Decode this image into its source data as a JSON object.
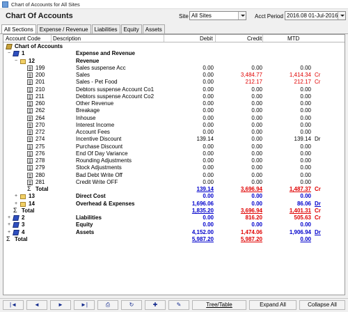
{
  "window": {
    "title": "Chart of Accounts for All Sites"
  },
  "header": {
    "title": "Chart Of Accounts",
    "site_label": "Site",
    "site_value": "All Sites",
    "period_label": "Acct Period",
    "period_value": "2016.08 01-Jul-2016"
  },
  "tabs": [
    "All Sections",
    "Expense / Revenue",
    "Liabilities",
    "Equity",
    "Assets"
  ],
  "columns": {
    "code": "Account Code",
    "desc": "Description",
    "debit": "Debit",
    "credit": "Credit",
    "mtd": "MTD"
  },
  "rows": [
    {
      "icon": "root-book-icon",
      "code": "Chart of Accounts",
      "desc": "",
      "debit": "",
      "credit": "",
      "mtd": "",
      "dc": ""
    },
    {
      "icon": "book-icon",
      "code": "1",
      "desc": "Expense and Revenue",
      "debit": "",
      "credit": "",
      "mtd": "",
      "dc": ""
    },
    {
      "icon": "folder-icon",
      "code": "12",
      "desc": "Revenue",
      "debit": "",
      "credit": "",
      "mtd": "",
      "dc": ""
    },
    {
      "icon": "doc-icon",
      "code": "199",
      "desc": "Sales suspense Acc",
      "debit": "0.00",
      "credit": "0.00",
      "mtd": "0.00",
      "dc": ""
    },
    {
      "icon": "doc-icon",
      "code": "200",
      "desc": "Sales",
      "debit": "0.00",
      "credit": "3,484.77",
      "mtd": "1,414.34",
      "dc": "Cr"
    },
    {
      "icon": "doc-icon",
      "code": "201",
      "desc": "Sales - Pet Food",
      "debit": "0.00",
      "credit": "212.17",
      "mtd": "212.17",
      "dc": "Cr"
    },
    {
      "icon": "doc-icon",
      "code": "210",
      "desc": "Debtors suspense Account Co1",
      "debit": "0.00",
      "credit": "0.00",
      "mtd": "0.00",
      "dc": ""
    },
    {
      "icon": "doc-icon",
      "code": "211",
      "desc": "Debtors suspense Account Co2",
      "debit": "0.00",
      "credit": "0.00",
      "mtd": "0.00",
      "dc": ""
    },
    {
      "icon": "doc-icon",
      "code": "260",
      "desc": "Other Revenue",
      "debit": "0.00",
      "credit": "0.00",
      "mtd": "0.00",
      "dc": ""
    },
    {
      "icon": "doc-icon",
      "code": "262",
      "desc": "Breakage",
      "debit": "0.00",
      "credit": "0.00",
      "mtd": "0.00",
      "dc": ""
    },
    {
      "icon": "doc-icon",
      "code": "264",
      "desc": "Inhouse",
      "debit": "0.00",
      "credit": "0.00",
      "mtd": "0.00",
      "dc": ""
    },
    {
      "icon": "doc-icon",
      "code": "270",
      "desc": "Interest Income",
      "debit": "0.00",
      "credit": "0.00",
      "mtd": "0.00",
      "dc": ""
    },
    {
      "icon": "doc-icon",
      "code": "272",
      "desc": "Account Fees",
      "debit": "0.00",
      "credit": "0.00",
      "mtd": "0.00",
      "dc": ""
    },
    {
      "icon": "doc-icon",
      "code": "274",
      "desc": "Incentive Discount",
      "debit": "139.14",
      "credit": "0.00",
      "mtd": "139.14",
      "dc": "Dr"
    },
    {
      "icon": "doc-icon",
      "code": "275",
      "desc": "Purchase Discount",
      "debit": "0.00",
      "credit": "0.00",
      "mtd": "0.00",
      "dc": ""
    },
    {
      "icon": "doc-icon",
      "code": "276",
      "desc": "End Of Day Variance",
      "debit": "0.00",
      "credit": "0.00",
      "mtd": "0.00",
      "dc": ""
    },
    {
      "icon": "doc-icon",
      "code": "278",
      "desc": "Rounding Adjustments",
      "debit": "0.00",
      "credit": "0.00",
      "mtd": "0.00",
      "dc": ""
    },
    {
      "icon": "doc-icon",
      "code": "279",
      "desc": "Stock Adjustments",
      "debit": "0.00",
      "credit": "0.00",
      "mtd": "0.00",
      "dc": ""
    },
    {
      "icon": "doc-icon",
      "code": "280",
      "desc": "Bad Debt Write Off",
      "debit": "0.00",
      "credit": "0.00",
      "mtd": "0.00",
      "dc": ""
    },
    {
      "icon": "doc-icon",
      "code": "281",
      "desc": "Credit Write OFF",
      "debit": "0.00",
      "credit": "0.00",
      "mtd": "0.00",
      "dc": ""
    },
    {
      "icon": "sigma-icon",
      "code": "Total",
      "desc": "",
      "debit": "139.14",
      "credit": "3,696.94",
      "mtd": "1,487.37",
      "dc": "Cr"
    },
    {
      "icon": "folder-icon",
      "code": "13",
      "desc": "Direct Cost",
      "debit": "0.00",
      "credit": "0.00",
      "mtd": "0.00",
      "dc": ""
    },
    {
      "icon": "folder-icon",
      "code": "14",
      "desc": "Overhead & Expenses",
      "debit": "1,696.06",
      "credit": "0.00",
      "mtd": "86.06",
      "dc": "Dr"
    },
    {
      "icon": "sigma-icon",
      "code": "Total",
      "desc": "",
      "debit": "1,835.20",
      "credit": "3,696.94",
      "mtd": "1,401.31",
      "dc": "Cr"
    },
    {
      "icon": "book-icon",
      "code": "2",
      "desc": "Liabilities",
      "debit": "0.00",
      "credit": "816.20",
      "mtd": "505.63",
      "dc": "Cr"
    },
    {
      "icon": "book-icon",
      "code": "3",
      "desc": "Equity",
      "debit": "0.00",
      "credit": "0.00",
      "mtd": "0.00",
      "dc": ""
    },
    {
      "icon": "book-icon",
      "code": "4",
      "desc": "Assets",
      "debit": "4,152.00",
      "credit": "1,474.06",
      "mtd": "1,906.94",
      "dc": "Dr"
    },
    {
      "icon": "sigma-icon",
      "code": "Total",
      "desc": "",
      "debit": "5,987.20",
      "credit": "5,987.20",
      "mtd": "0.00",
      "dc": ""
    }
  ],
  "navbar": {
    "first": "|◄",
    "prev": "◄",
    "next": "►",
    "last": "►|",
    "tree_table": "Tree/Table",
    "expand_all": "Expand All",
    "collapse_all": "Collapse All"
  },
  "colors": {
    "credit_red": "#e00000",
    "total_blue": "#0000cc",
    "book_icon": "#2f4fbf",
    "folder_icon": "#f2d066"
  }
}
